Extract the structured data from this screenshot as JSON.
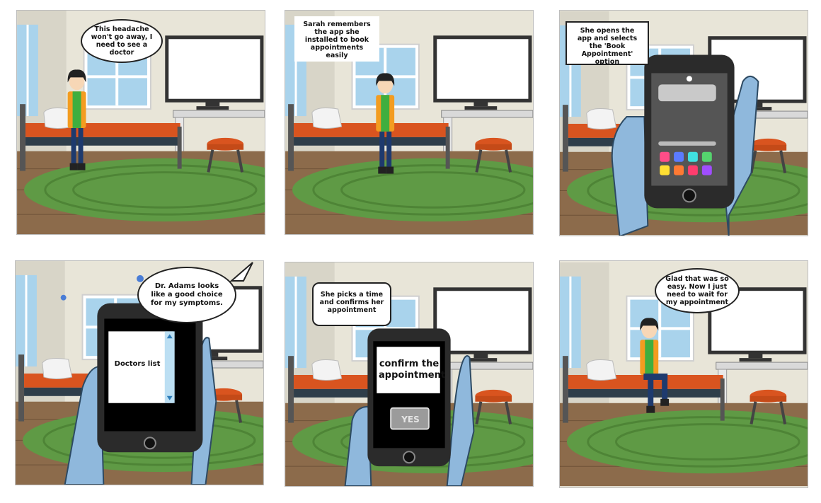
{
  "panels": [
    {
      "id": 1,
      "text": "This headache won't go away, I need to see a doctor"
    },
    {
      "id": 2,
      "text": "Sarah remembers the app she installed to book appointments easily"
    },
    {
      "id": 3,
      "text": "She opens the app and selects the 'Book Appointment' option"
    },
    {
      "id": 4,
      "text": "Dr. Adams looks like a good choice for my symptoms.",
      "screen": "Doctors list"
    },
    {
      "id": 5,
      "text": "She picks a time and confirms her appointment",
      "screen": "confirm the appointment",
      "button": "YES"
    },
    {
      "id": 6,
      "text": "Glad that was so easy. Now I just need to wait for my appointment"
    }
  ],
  "colors": {
    "wall": "#e9e6da",
    "floor": "#8a6a4a",
    "rug": "#5f9a45",
    "bed": "#d9541f",
    "shirt": "#3fae3f",
    "jacket": "#f39c20",
    "hand": "#8fb8dc",
    "phone": "#2b2b2b"
  }
}
